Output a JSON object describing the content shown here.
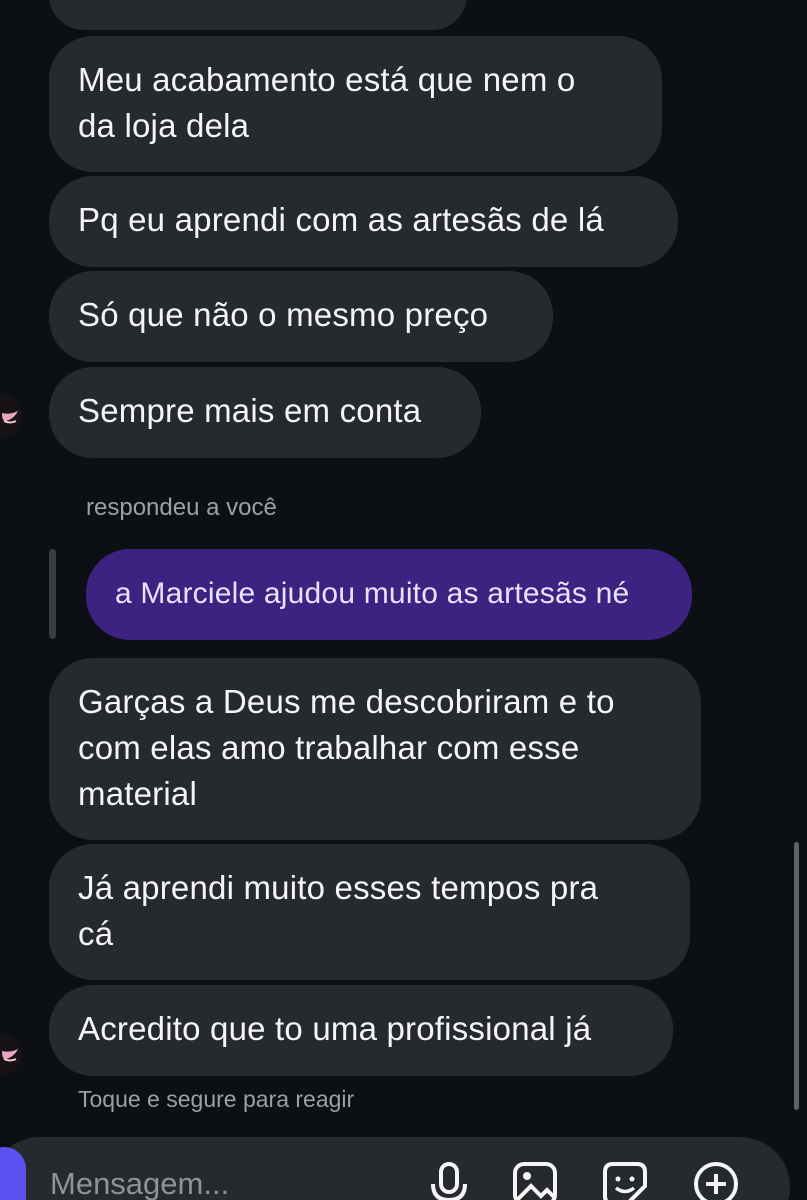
{
  "messages": [
    {
      "id": "m1",
      "text": "Meu acabamento está que nem o da loja dela",
      "lines": [
        "Meu acabamento está que nem o",
        "da loja dela"
      ]
    },
    {
      "id": "m2",
      "text": "Pq eu aprendi com as artesãs de lá"
    },
    {
      "id": "m3",
      "text": "Só que não o mesmo preço"
    },
    {
      "id": "m4",
      "text": "Sempre mais em conta"
    },
    {
      "id": "m5",
      "text": "Garças a Deus me descobriram e to com elas amo trabalhar com esse material",
      "lines": [
        "Garças a Deus me descobriram e to",
        "com elas amo trabalhar com esse",
        "material"
      ]
    },
    {
      "id": "m6",
      "text": "Já aprendi muito esses tempos pra cá",
      "lines": [
        "Já aprendi muito esses tempos pra",
        "cá"
      ]
    },
    {
      "id": "m7",
      "text": "Acredito que to uma profissional já"
    }
  ],
  "reply_context": {
    "label": "respondeu a você",
    "quoted_text": "a Marciele ajudou muito as artesãs né"
  },
  "hint": "Toque e segure para reagir",
  "composer": {
    "placeholder": "Mensagem..."
  },
  "icons": {
    "avatar": "avatar-image",
    "microphone": "microphone-icon",
    "gallery": "gallery-icon",
    "sticker": "sticker-icon",
    "add": "add-circle-icon"
  },
  "colors": {
    "background": "#0c1014",
    "received_bubble": "#262a2f",
    "sent_bubble": "#3d2282",
    "accent": "#5b51f0"
  }
}
